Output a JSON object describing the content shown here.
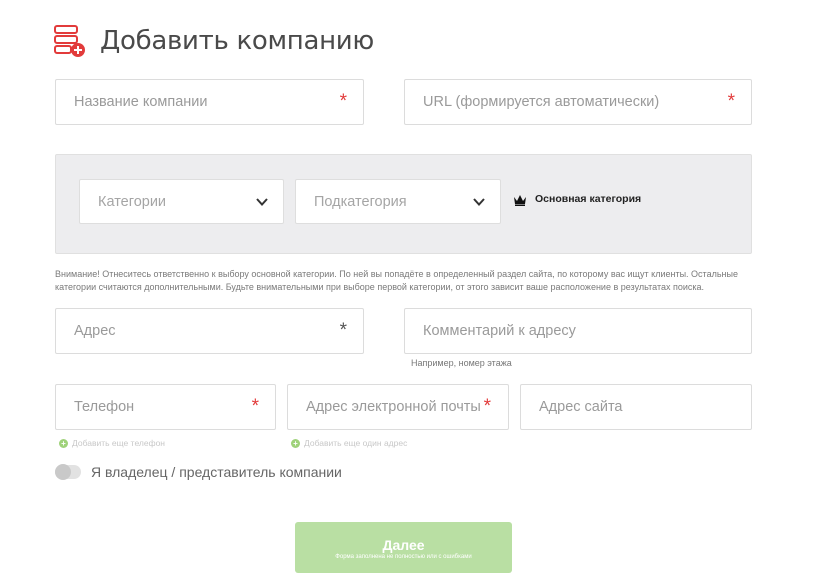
{
  "header": {
    "title": "Добавить компанию",
    "icon": "server-add-icon",
    "accent_color": "#e23b3b"
  },
  "fields": {
    "company_name": {
      "placeholder": "Название компании",
      "required_mark": "*"
    },
    "url": {
      "placeholder": "URL (формируется автоматически)",
      "required_mark": "*"
    },
    "address": {
      "placeholder": "Адрес",
      "required_mark": "*"
    },
    "address_comment": {
      "placeholder": "Комментарий к адресу",
      "hint": "Например, номер этажа"
    },
    "phone": {
      "placeholder": "Телефон",
      "required_mark": "*",
      "add_link": "Добавить еще телефон"
    },
    "email": {
      "placeholder": "Адрес электронной почты",
      "required_mark": "*",
      "add_link": "Добавить еще один адрес"
    },
    "website": {
      "placeholder": "Адрес сайта"
    }
  },
  "categories": {
    "category_select": "Категории",
    "subcategory_select": "Подкатегория",
    "main_category_label": "Основная категория",
    "main_category_icon": "crown-icon",
    "note": "Внимание! Отнеситесь ответственно к выбору основной категории. По ней вы попадёте в определенный раздел сайта, по которому вас ищут клиенты. Остальные категории считаются дополнительными. Будьте внимательными при выборе первой категории, от этого зависит ваше расположение в результатах поиска."
  },
  "owner_toggle": {
    "label": "Я владелец / представитель компании",
    "on": false
  },
  "submit": {
    "label": "Далее",
    "sublabel": "Форма заполнена не полностью или с ошибками",
    "color": "#b9dfa3"
  }
}
